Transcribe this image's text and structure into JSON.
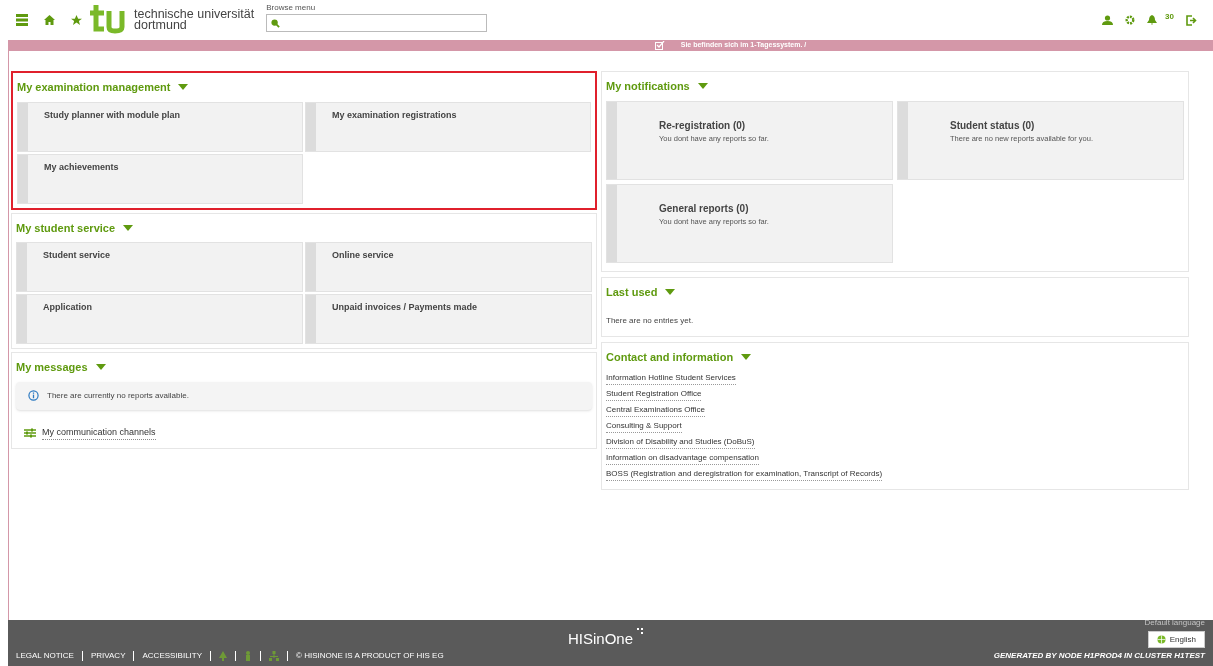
{
  "header": {
    "logo_line1": "technische universität",
    "logo_line2": "dortmund",
    "search_label": "Browse menu",
    "notification_count": "30"
  },
  "info_bar": {
    "text": "Sie befinden sich im 1-Tagessystem. /"
  },
  "left": [
    {
      "kind": "tiles",
      "title": "My examination management",
      "highlighted": true,
      "tiles": [
        "Study planner with module plan",
        "My examination registrations",
        "My achievements"
      ]
    },
    {
      "kind": "tiles",
      "title": "My student service",
      "highlighted": false,
      "tiles": [
        "Student service",
        "Online service",
        "Application",
        "Unpaid invoices / Payments made"
      ]
    },
    {
      "kind": "messages",
      "title": "My messages",
      "notice": "There are currently no reports available.",
      "link": "My communication channels"
    }
  ],
  "right": [
    {
      "kind": "reports",
      "title": "My notifications",
      "tiles": [
        {
          "title": "Re-registration (0)",
          "text": "You dont have any reports so far."
        },
        {
          "title": "Student status (0)",
          "text": "There are no new reports available for you."
        },
        {
          "title": "General reports (0)",
          "text": "You dont have any reports so far."
        }
      ]
    },
    {
      "kind": "text",
      "title": "Last used",
      "text": "There are no entries yet."
    },
    {
      "kind": "links",
      "title": "Contact and information",
      "links": [
        "Information Hotline Student Services",
        "Student Registration Office",
        "Central Examinations Office",
        "Consulting & Support",
        "Division of Disability and Studies (DoBuS)",
        "Information on disadvantage compensation",
        "BOSS (Registration and deregistration for examination, Transcript of Records)"
      ]
    }
  ],
  "footer": {
    "links": [
      "LEGAL NOTICE",
      "PRIVACY",
      "ACCESSIBILITY"
    ],
    "credit": "© HISINONE IS A PRODUCT OF HIS EG",
    "brand": "HISinOne",
    "language_label": "Default language",
    "language": "English",
    "generated": "GENERATED BY NODE H1PROD4 IN CLUSTER H1TEST"
  }
}
